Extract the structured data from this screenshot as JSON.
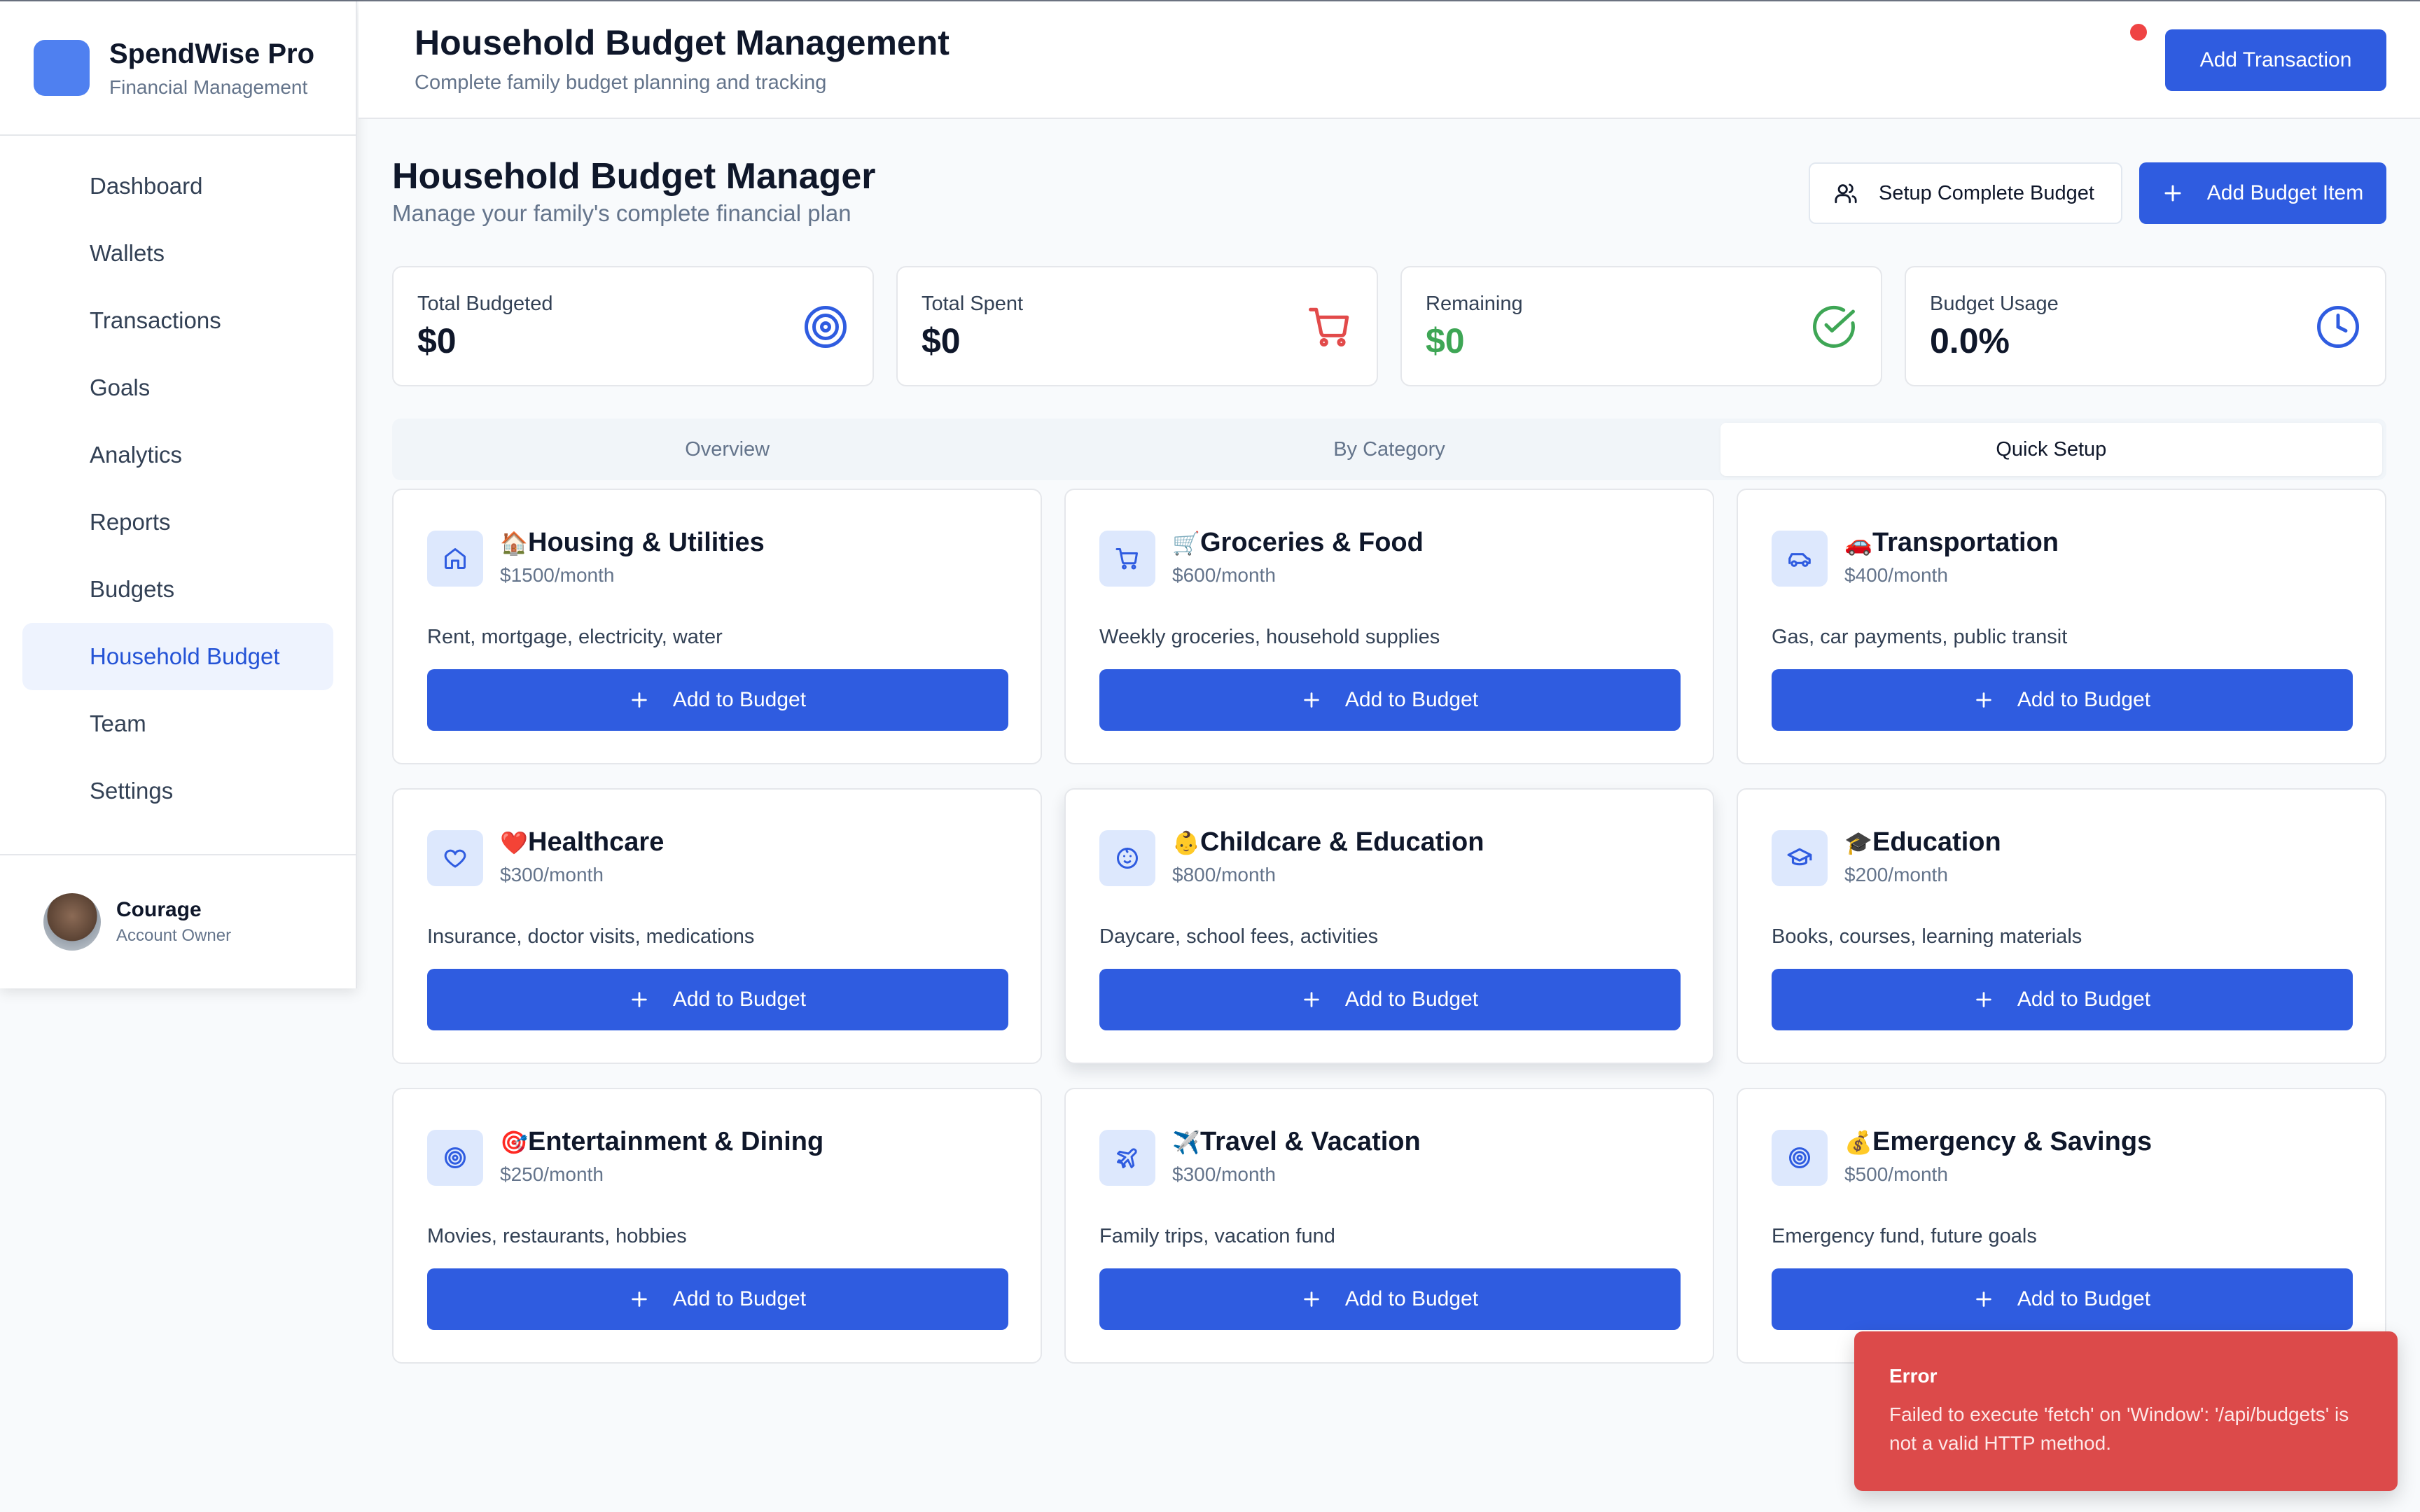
{
  "app": {
    "name": "SpendWise Pro",
    "tagline": "Financial Management"
  },
  "sidebar": {
    "items": [
      {
        "label": "Dashboard"
      },
      {
        "label": "Wallets"
      },
      {
        "label": "Transactions"
      },
      {
        "label": "Goals"
      },
      {
        "label": "Analytics"
      },
      {
        "label": "Reports"
      },
      {
        "label": "Budgets"
      },
      {
        "label": "Household Budget",
        "active": true
      },
      {
        "label": "Team"
      },
      {
        "label": "Settings"
      }
    ],
    "user": {
      "name": "Courage",
      "role": "Account Owner"
    }
  },
  "header": {
    "title": "Household Budget Management",
    "subtitle": "Complete family budget planning and tracking",
    "add_transaction_label": "Add Transaction"
  },
  "main": {
    "title": "Household Budget Manager",
    "subtitle": "Manage your family's complete financial plan",
    "setup_button_label": "Setup Complete Budget",
    "add_item_button_label": "Add Budget Item",
    "stats": [
      {
        "label": "Total Budgeted",
        "value": "$0",
        "icon": "target-icon"
      },
      {
        "label": "Total Spent",
        "value": "$0",
        "icon": "cart-icon"
      },
      {
        "label": "Remaining",
        "value": "$0",
        "icon": "check-circle-icon"
      },
      {
        "label": "Budget Usage",
        "value": "0.0%",
        "icon": "clock-icon"
      }
    ],
    "tabs": [
      {
        "label": "Overview"
      },
      {
        "label": "By Category"
      },
      {
        "label": "Quick Setup",
        "active": true
      }
    ],
    "add_to_budget_label": "Add to Budget",
    "categories": [
      {
        "emoji": "🏠",
        "name": "Housing & Utilities",
        "price": "$1500/month",
        "desc": "Rent, mortgage, electricity, water",
        "icon": "home-icon"
      },
      {
        "emoji": "🛒",
        "name": "Groceries & Food",
        "price": "$600/month",
        "desc": "Weekly groceries, household supplies",
        "icon": "cart-icon"
      },
      {
        "emoji": "🚗",
        "name": "Transportation",
        "price": "$400/month",
        "desc": "Gas, car payments, public transit",
        "icon": "car-icon"
      },
      {
        "emoji": "❤️",
        "name": "Healthcare",
        "price": "$300/month",
        "desc": "Insurance, doctor visits, medications",
        "icon": "heart-icon"
      },
      {
        "emoji": "👶",
        "name": "Childcare & Education",
        "price": "$800/month",
        "desc": "Daycare, school fees, activities",
        "icon": "baby-icon"
      },
      {
        "emoji": "🎓",
        "name": "Education",
        "price": "$200/month",
        "desc": "Books, courses, learning materials",
        "icon": "graduation-cap-icon"
      },
      {
        "emoji": "🎯",
        "name": "Entertainment & Dining",
        "price": "$250/month",
        "desc": "Movies, restaurants, hobbies",
        "icon": "target-icon"
      },
      {
        "emoji": "✈️",
        "name": "Travel & Vacation",
        "price": "$300/month",
        "desc": "Family trips, vacation fund",
        "icon": "plane-icon"
      },
      {
        "emoji": "💰",
        "name": "Emergency & Savings",
        "price": "$500/month",
        "desc": "Emergency fund, future goals",
        "icon": "target-icon"
      }
    ]
  },
  "toast": {
    "title": "Error",
    "message": "Failed to execute 'fetch' on 'Window': '/api/budgets' is not a valid HTTP method."
  },
  "colors": {
    "primary": "#2f5ce0",
    "active_nav_bg": "#eef3fe",
    "success": "#3ea655",
    "danger": "#dc4a4a",
    "icon_tile": "#dde8fd"
  }
}
